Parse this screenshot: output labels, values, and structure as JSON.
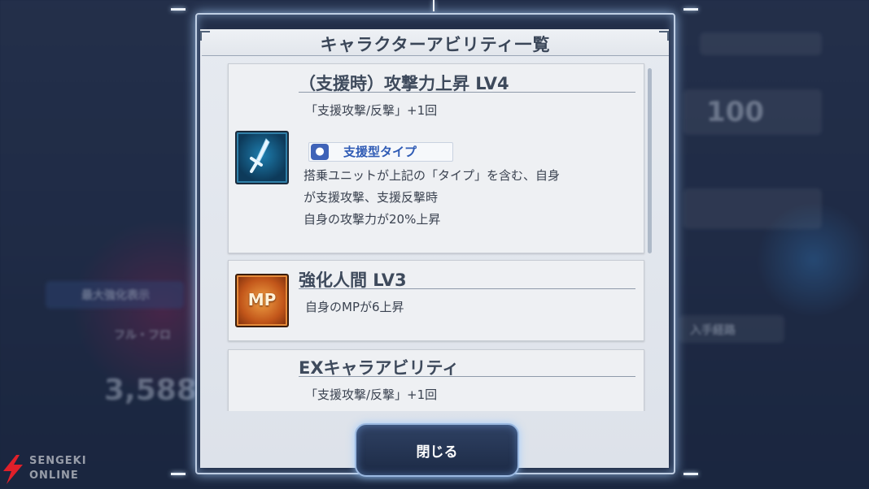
{
  "dialog": {
    "title": "キャラクターアビリティ一覧",
    "close_label": "閉じる"
  },
  "abilities": [
    {
      "name": "（支援時）攻撃力上昇 LV4",
      "effect": "「支援攻撃/反撃」+1回",
      "tag": "支援型タイプ",
      "desc": [
        "搭乗ユニットが上記の「タイプ」を含む、自身",
        "が支援攻撃、支援反撃時",
        "自身の攻撃力が20%上昇"
      ],
      "icon": "sword-icon"
    },
    {
      "name": "強化人間 LV3",
      "effect": "自身のMPが6上昇",
      "icon_label": "MP",
      "icon": "mp-icon"
    },
    {
      "name": "EXキャラアビリティ",
      "effect": "「支援攻撃/反撃」+1回"
    }
  ],
  "background": {
    "stat_value": "100",
    "max_strengthen_label": "最大強化表示",
    "unit_name": "フル・フロ",
    "power_value": "3,588",
    "acquire_label": "入手経路"
  },
  "watermark": {
    "line1": "SENGEKI",
    "line2": "ONLINE"
  }
}
